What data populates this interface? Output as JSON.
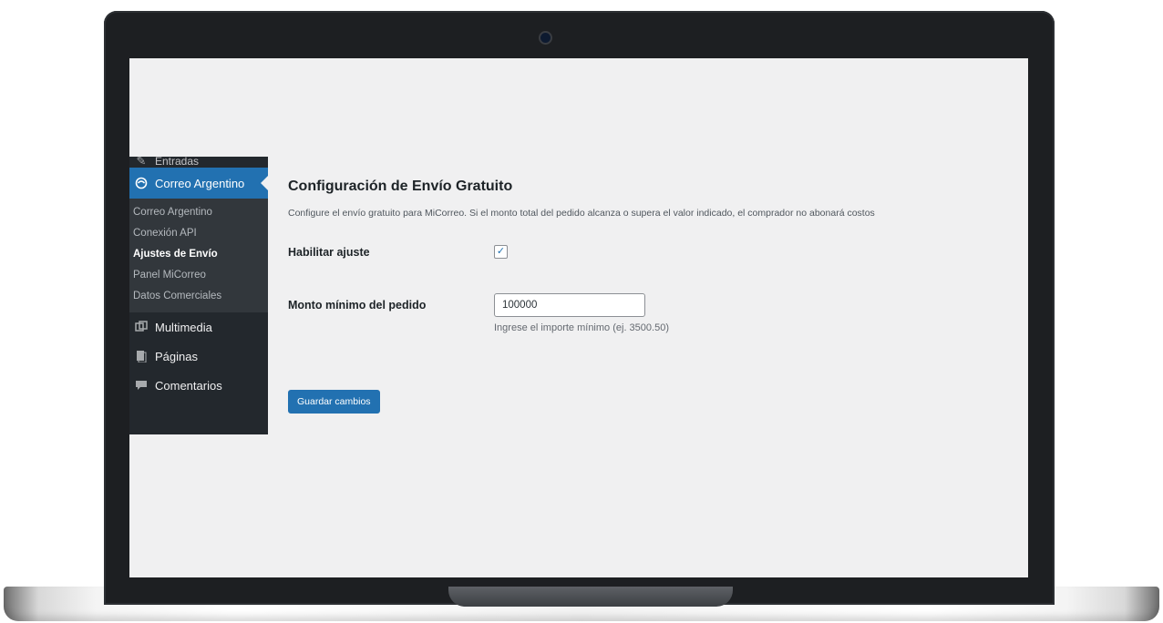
{
  "sidebar": {
    "items_top": [
      {
        "label": "Entradas",
        "icon": "pin-icon"
      }
    ],
    "active": {
      "label": "Correo Argentino",
      "icon": "correo-argentino-icon"
    },
    "submenu": [
      {
        "label": "Correo Argentino"
      },
      {
        "label": "Conexión API"
      },
      {
        "label": "Ajustes de Envío",
        "current": true
      },
      {
        "label": "Panel MiCorreo"
      },
      {
        "label": "Datos Comerciales"
      }
    ],
    "items_bottom": [
      {
        "label": "Multimedia",
        "icon": "media-icon"
      },
      {
        "label": "Páginas",
        "icon": "pages-icon"
      },
      {
        "label": "Comentarios",
        "icon": "comments-icon"
      }
    ]
  },
  "main": {
    "title": "Configuración de Envío Gratuito",
    "description": "Configure el envío gratuito para MiCorreo. Si el monto total del pedido alcanza o supera el valor indicado, el comprador no abonará costos",
    "enable_label": "Habilitar ajuste",
    "enable_checked": true,
    "min_amount_label": "Monto mínimo del pedido",
    "min_amount_value": "100000",
    "min_amount_hint": "Ingrese el importe mínimo (ej. 3500.50)",
    "save_button": "Guardar cambios"
  },
  "colors": {
    "accent": "#2271b1",
    "sidebar_bg": "#23282d",
    "submenu_bg": "#32373c",
    "content_bg": "#f0f0f1"
  }
}
